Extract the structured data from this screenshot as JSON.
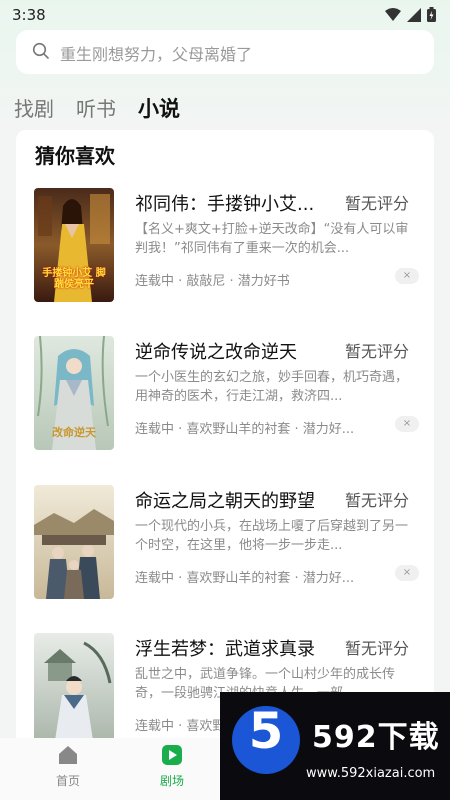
{
  "status": {
    "time": "3:38"
  },
  "search": {
    "placeholder": "重生刚想努力，父母离婚了"
  },
  "tabs": [
    {
      "label": "找剧",
      "active": false
    },
    {
      "label": "听书",
      "active": false
    },
    {
      "label": "小说",
      "active": true
    }
  ],
  "section": {
    "title": "猜你喜欢"
  },
  "books": [
    {
      "title": "祁同伟：手搂钟小艾...",
      "rating": "暂无评分",
      "description": "【名义+爽文+打脸+逆天改命】“没有人可以审判我！”祁同伟有了重来一次的机会...",
      "meta": "连载中 · 敲敲尼 · 潜力好书",
      "cover_text": "手搂钟小艾 脚踹侯亮平"
    },
    {
      "title": "逆命传说之改命逆天",
      "rating": "暂无评分",
      "description": "一个小医生的玄幻之旅，妙手回春，机巧奇遇，用神奇的医术，行走江湖，救济四...",
      "meta": "连载中 · 喜欢野山羊的衬套 · 潜力好...",
      "cover_text": "改命逆天"
    },
    {
      "title": "命运之局之朝天的野望",
      "rating": "暂无评分",
      "description": "一个现代的小兵，在战场上嗄了后穿越到了另一个时空，在这里，他将一步一步走...",
      "meta": "连载中 · 喜欢野山羊的衬套 · 潜力好...",
      "cover_text": ""
    },
    {
      "title": "浮生若梦：武道求真录",
      "rating": "暂无评分",
      "description": "乱世之中，武道争锋。一个山村少年的成长传奇，一段驰骋江湖的快意人生，一部...",
      "meta": "连载中 · 喜欢野山羊的衬套 · 潜力好...",
      "cover_text": ""
    }
  ],
  "close_symbol": "×",
  "nav": [
    {
      "label": "首页",
      "active": false,
      "color": "#888888"
    },
    {
      "label": "剧场",
      "active": true,
      "color": "#1aad4b"
    }
  ],
  "watermark": {
    "digit": "5",
    "brand": "592下载",
    "url": "www.592xiazai.com"
  },
  "colors": {
    "accent": "#1aad4b",
    "watermark_blue": "#1a56d6"
  }
}
